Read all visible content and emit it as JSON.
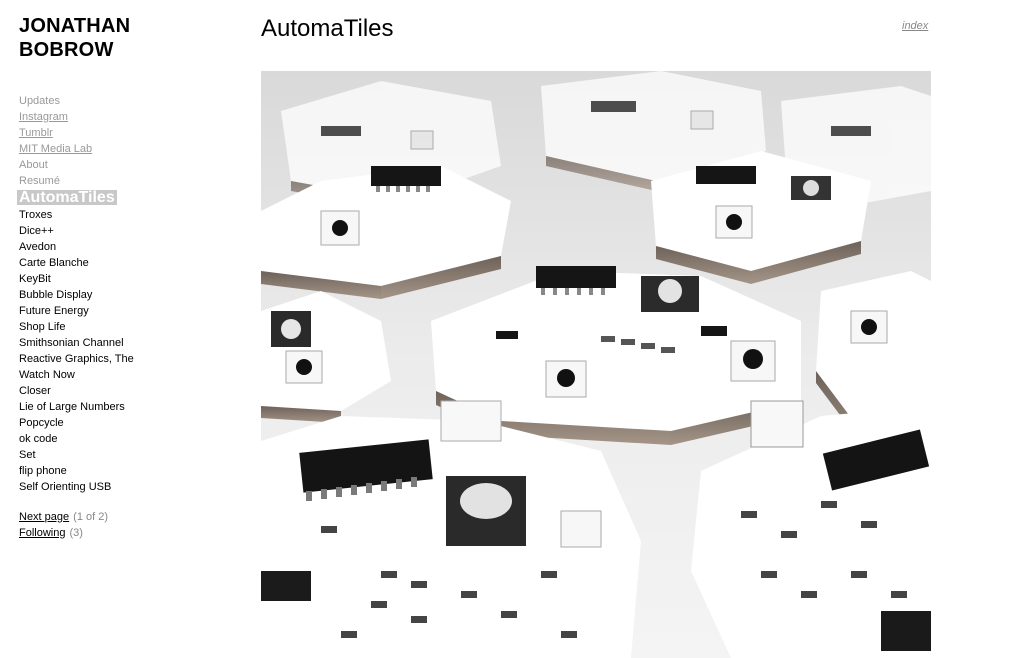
{
  "site": {
    "name_line1": "JONATHAN",
    "name_line2": "BOBROW"
  },
  "nav": {
    "links": [
      {
        "label": "Updates"
      },
      {
        "label": "Instagram"
      },
      {
        "label": "Tumblr"
      },
      {
        "label": "MIT Media Lab"
      },
      {
        "label": "About"
      },
      {
        "label": "Resumé"
      }
    ],
    "active": "AutomaTiles",
    "projects": [
      "Troxes",
      "Dice++",
      "Avedon",
      "Carte Blanche",
      "KeyBit",
      "Bubble Display",
      "Future Energy",
      "Shop Life",
      "Smithsonian Channel",
      "Reactive Graphics, The",
      "Watch Now",
      "Closer",
      "Lie of Large Numbers",
      "Popcycle",
      "ok code",
      "Set",
      "flip phone",
      "Self Orienting USB"
    ]
  },
  "pager": {
    "next_label": "Next page",
    "next_count": "(1 of 2)",
    "following_label": "Following",
    "following_count": "(3)"
  },
  "main": {
    "title": "AutomaTiles",
    "index_label": "index"
  },
  "colors": {
    "nav_muted": "#999999",
    "active_bg": "#c8c8c8",
    "text": "#000000"
  }
}
